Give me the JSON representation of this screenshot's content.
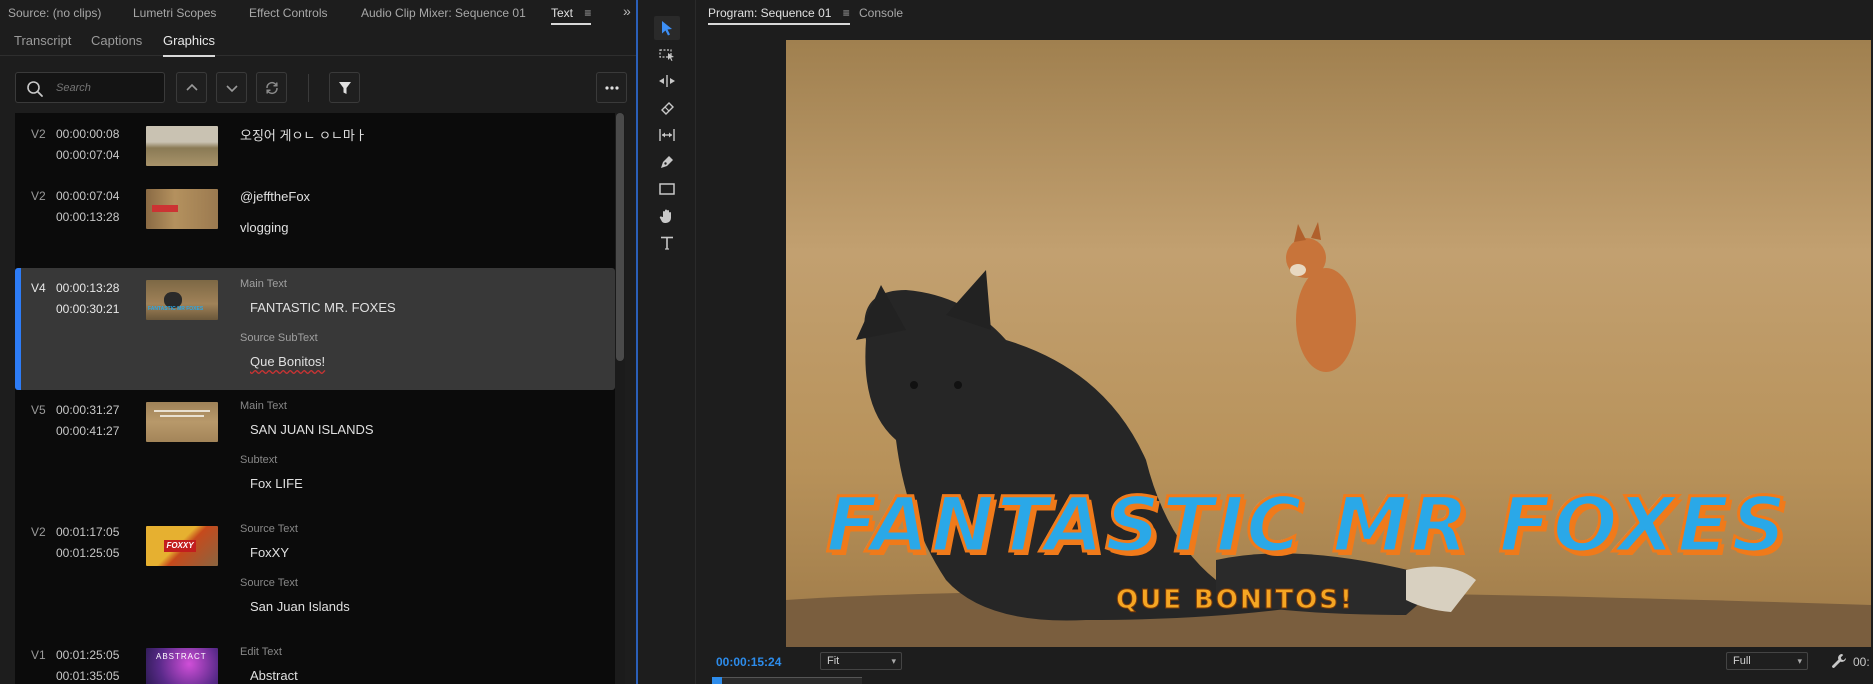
{
  "left_panel": {
    "tabs": [
      {
        "label": "Source: (no clips)"
      },
      {
        "label": "Lumetri Scopes"
      },
      {
        "label": "Effect Controls"
      },
      {
        "label": "Audio Clip Mixer: Sequence 01"
      },
      {
        "label": "Text"
      }
    ],
    "overflow_label": "»",
    "menu_glyph": "≡",
    "subtabs": [
      {
        "label": "Transcript"
      },
      {
        "label": "Captions"
      },
      {
        "label": "Graphics"
      }
    ],
    "search": {
      "placeholder": "Search"
    },
    "items": [
      {
        "track": "V2",
        "in": "00:00:00:08",
        "out": "00:00:07:04",
        "lines": [
          {
            "type": "plain",
            "text": "오징어 게ㅇㄴ ㅇㄴ마ㅏ"
          }
        ]
      },
      {
        "track": "V2",
        "in": "00:00:07:04",
        "out": "00:00:13:28",
        "lines": [
          {
            "type": "plain",
            "text": "@jefftheFox"
          },
          {
            "type": "plain",
            "text": "vlogging"
          }
        ]
      },
      {
        "track": "V4",
        "in": "00:00:13:28",
        "out": "00:00:30:21",
        "selected": true,
        "thumb_caption": "FANTASTIC MR FOXES",
        "lines": [
          {
            "type": "label",
            "text": "Main Text"
          },
          {
            "type": "value",
            "text": "FANTASTIC MR. FOXES"
          },
          {
            "type": "label",
            "text": "Source SubText"
          },
          {
            "type": "value",
            "text": "Que Bonitos!"
          }
        ]
      },
      {
        "track": "V5",
        "in": "00:00:31:27",
        "out": "00:00:41:27",
        "lines": [
          {
            "type": "label",
            "text": "Main Text"
          },
          {
            "type": "value",
            "text": "SAN JUAN ISLANDS"
          },
          {
            "type": "label",
            "text": "Subtext"
          },
          {
            "type": "value",
            "text": "Fox LIFE"
          }
        ]
      },
      {
        "track": "V2",
        "in": "00:01:17:05",
        "out": "00:01:25:05",
        "thumb_caption": "FOXXY",
        "lines": [
          {
            "type": "label",
            "text": "Source Text"
          },
          {
            "type": "value",
            "text": "FoxXY"
          },
          {
            "type": "label",
            "text": "Source Text"
          },
          {
            "type": "value",
            "text": "San Juan Islands"
          }
        ]
      },
      {
        "track": "V1",
        "in": "00:01:25:05",
        "out": "00:01:35:05",
        "thumb_caption": "ABSTRACT",
        "lines": [
          {
            "type": "label",
            "text": "Edit Text"
          },
          {
            "type": "value",
            "text": "Abstract"
          }
        ]
      }
    ]
  },
  "program": {
    "tab_label": "Program: Sequence 01",
    "console_label": "Console",
    "menu_glyph": "≡",
    "title_overlay": "FANTASTIC MR FOXES",
    "subtitle_overlay": "QUE BONITOS!",
    "timecode": "00:00:15:24",
    "timecode_end": "00:",
    "fit_value": "Fit",
    "quality_value": "Full"
  },
  "colors": {
    "accent_blue": "#2d7cf6",
    "timecode_blue": "#2d8ceb",
    "title_fill": "#2aa8e8",
    "title_outline": "#f07a1a",
    "subtitle_fill": "#f5a623"
  }
}
